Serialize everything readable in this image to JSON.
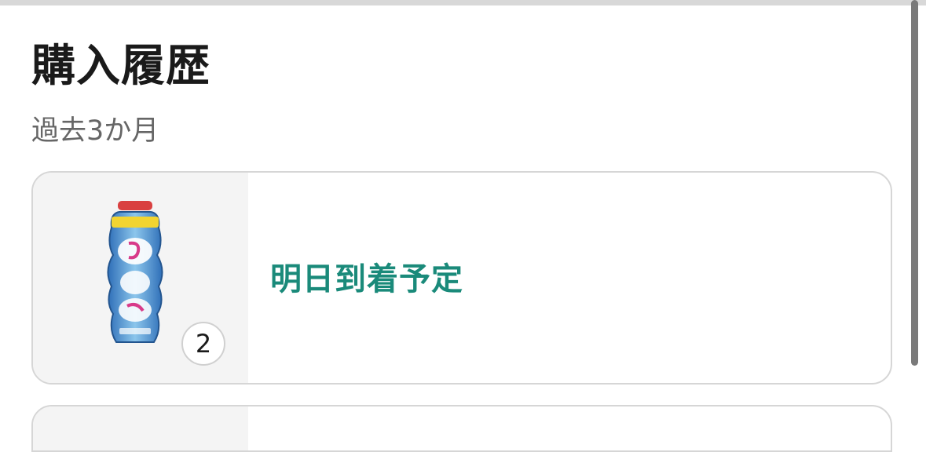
{
  "page": {
    "title": "購入履歴",
    "period": "過去3か月"
  },
  "orders": [
    {
      "status": "明日到着予定",
      "quantity": "2",
      "product_image": "gummy-candy-bottle-image"
    }
  ],
  "colors": {
    "status_text": "#1a8a7a",
    "thumbnail_bg": "#f4f4f4",
    "card_border": "#d6d6d6"
  }
}
